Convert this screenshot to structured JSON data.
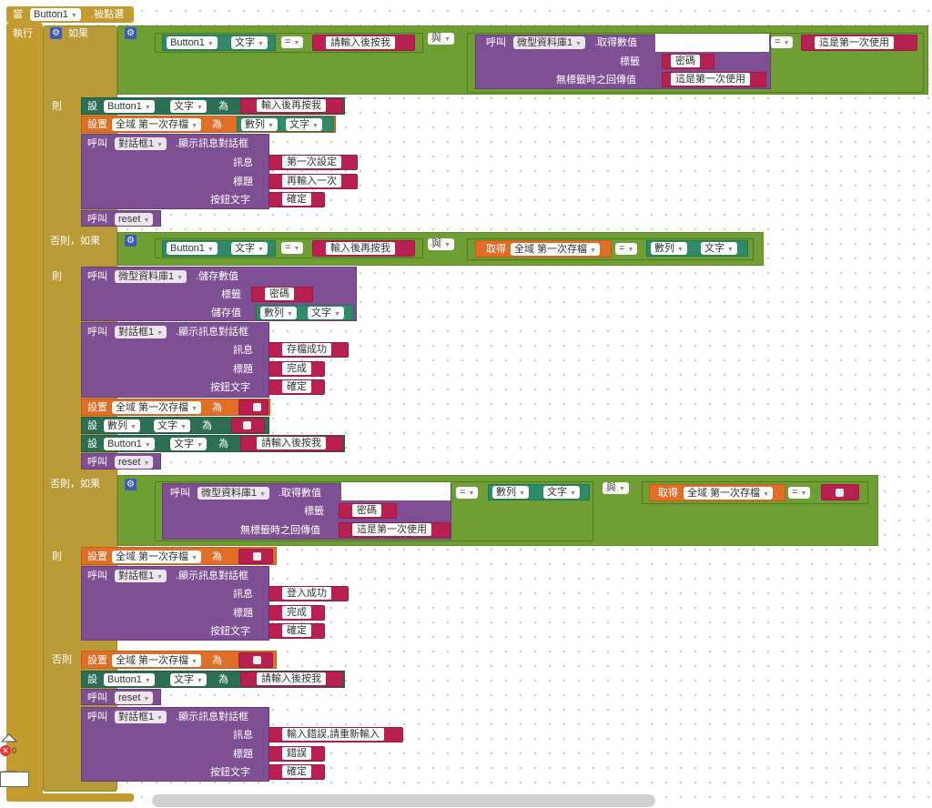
{
  "event": {
    "when": "當",
    "component": "Button1",
    "clicked": ".被點選",
    "do": "執行"
  },
  "ctrl": {
    "if": "如果",
    "then": "則",
    "elseif": "否則，如果",
    "else": "否則"
  },
  "words": {
    "set": "設",
    "to": "為",
    "call": "呼叫",
    "get": "取得",
    "and": "與",
    "eq": "=",
    "set_global": "設置",
    "global_var": "全域 第一次存檔",
    "tinydb": "微型資料庫1",
    "getvalue": ".取得數值",
    "storevalue": ".儲存數值",
    "tag": "標籤",
    "notfound": "無標籤時之回傳值",
    "valuetostore": "儲存值",
    "notifier": "對話框1",
    "showalert": ".顯示訊息對話框",
    "message": "訊息",
    "title": "標題",
    "buttontext": "按鈕文字",
    "reset": "reset",
    "button1": "Button1",
    "textprop": "文字",
    "number": "數列"
  },
  "strings": {
    "enter_then_press": "請輸入後按我",
    "re_enter_press": "輸入後再按我",
    "password": "密碼",
    "first_time_use": "這是第一次使用",
    "first_time_set": "第一次設定",
    "enter_once_more": "再輸入一次",
    "ok": "確定",
    "save_success": "存檔成功",
    "done": "完成",
    "login_success": "登入成功",
    "input_error": "輸入錯誤,請重新輸入",
    "error": "錯誤"
  },
  "workspace": {
    "trash_count": "0"
  },
  "colors": {
    "event": "#c39b2e",
    "logic": "#6f9e34",
    "procedure": "#7f4f93",
    "variable": "#e06e26",
    "component_set": "#2c6e54",
    "component_get": "#2f8a66",
    "text": "#b8204f"
  }
}
